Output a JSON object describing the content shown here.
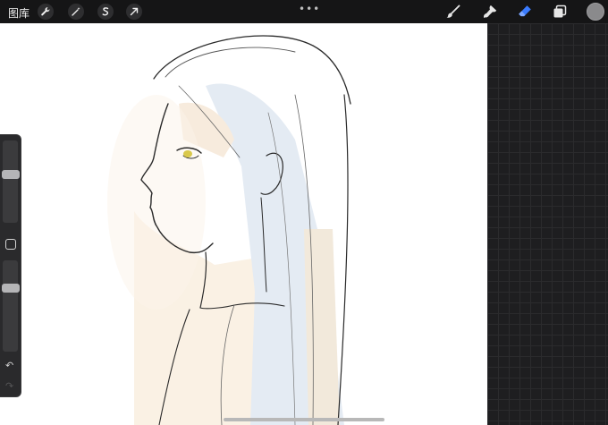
{
  "toolbar": {
    "gallery_label": "图库",
    "left_tools": [
      {
        "icon": "wrench-icon",
        "name": "actions"
      },
      {
        "icon": "magic-wand-icon",
        "name": "adjustments"
      },
      {
        "icon": "selection-s-icon",
        "name": "selection"
      },
      {
        "icon": "arrow-cursor-icon",
        "name": "transform"
      }
    ],
    "more_dots": "•••",
    "right_tools": [
      {
        "icon": "brush-icon",
        "name": "paint"
      },
      {
        "icon": "smudge-icon",
        "name": "smudge"
      },
      {
        "icon": "eraser-icon",
        "name": "erase",
        "active": true
      },
      {
        "icon": "layers-icon",
        "name": "layers"
      }
    ],
    "current_color": "#8a8a8c",
    "accent": "#3a7bff"
  },
  "sidebar": {
    "brush_size_level": 0.6,
    "opacity_level": 0.72,
    "undo_glyph": "↶",
    "redo_glyph": "↷"
  },
  "canvas": {
    "background": "#ffffff",
    "subject": "sketch"
  }
}
